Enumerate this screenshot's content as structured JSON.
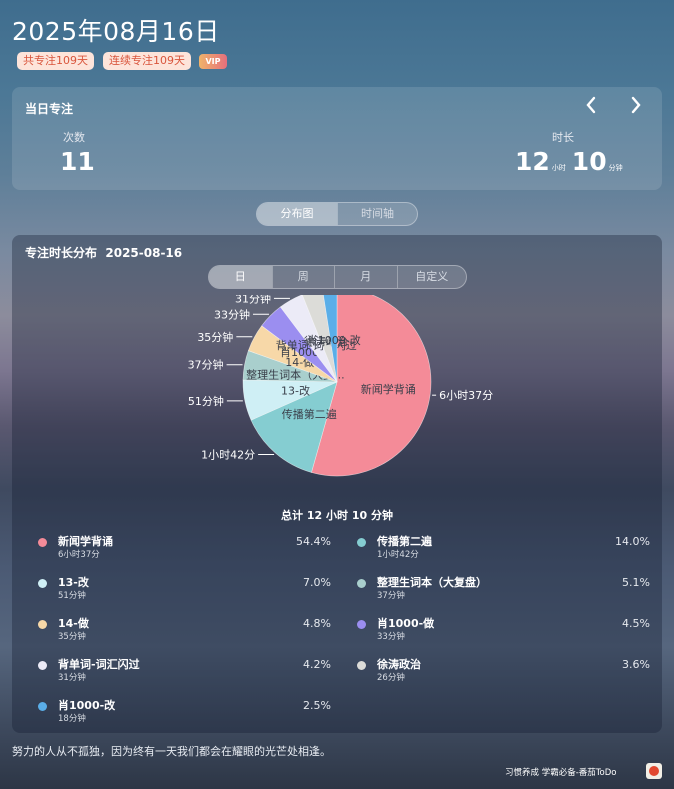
{
  "header": {
    "date": "2025年08月16日",
    "total_days_badge": "共专注109天",
    "streak_badge": "连续专注109天",
    "vip_badge": "VIP"
  },
  "daily": {
    "title": "当日专注",
    "count_label": "次数",
    "count_value": "11",
    "duration_label": "时长",
    "hours": "12",
    "hours_unit": "小时",
    "minutes": "10",
    "minutes_unit": "分钟",
    "prev_icon": "chevron-left-icon",
    "next_icon": "chevron-right-icon"
  },
  "view_tabs": [
    "分布图",
    "时间轴"
  ],
  "distribution": {
    "title": "专注时长分布",
    "date": "2025-08-16",
    "range_tabs": [
      "日",
      "周",
      "月",
      "自定义"
    ],
    "total_text": "总计 12 小时 10 分钟"
  },
  "chart_data": {
    "type": "pie",
    "title": "",
    "slices": [
      {
        "name": "新闻学背诵",
        "duration": "6小时37分",
        "minutes": 397,
        "percent": "54.4%",
        "color": "#f48b98",
        "outer_label": "6小时37分",
        "inner_label": "新闻学背诵"
      },
      {
        "name": "传播第二遍",
        "duration": "1小时42分",
        "minutes": 102,
        "percent": "14.0%",
        "color": "#85cdd1",
        "outer_label": "1小时42分",
        "inner_label": "传播第二遍"
      },
      {
        "name": "13-改",
        "duration": "51分钟",
        "minutes": 51,
        "percent": "7.0%",
        "color": "#cfeff5",
        "outer_label": "51分钟",
        "inner_label": "13-改"
      },
      {
        "name": "整理生词本（大复盘）",
        "duration": "37分钟",
        "minutes": 37,
        "percent": "5.1%",
        "color": "#a9cfcd",
        "outer_label": "37分钟",
        "inner_label": "整理生词本（大复..."
      },
      {
        "name": "14-做",
        "duration": "35分钟",
        "minutes": 35,
        "percent": "4.8%",
        "color": "#f7d8a8",
        "outer_label": "35分钟",
        "inner_label": "14-做"
      },
      {
        "name": "肖1000-做",
        "duration": "33分钟",
        "minutes": 33,
        "percent": "4.5%",
        "color": "#9b8ef0",
        "outer_label": "33分钟",
        "inner_label": "肖1000-做"
      },
      {
        "name": "背单词-词汇闪过",
        "duration": "31分钟",
        "minutes": 31,
        "percent": "4.2%",
        "color": "#ecebf7",
        "outer_label": "31分钟",
        "inner_label": "背单词-词汇闪过"
      },
      {
        "name": "徐涛政治",
        "duration": "26分钟",
        "minutes": 26,
        "percent": "3.6%",
        "color": "#dcdcd8",
        "outer_label": "26分钟",
        "inner_label": "徐涛政治"
      },
      {
        "name": "肖1000-改",
        "duration": "18分钟",
        "minutes": 18,
        "percent": "2.5%",
        "color": "#5aaee8",
        "outer_label": "18分钟",
        "inner_label": "肖1000-改"
      }
    ]
  },
  "footer": {
    "quote": "努力的人从不孤独，因为终有一天我们都会在耀眼的光芒处相逢。",
    "brand": "习惯养成 学霸必备-番茄ToDo",
    "brand_icon": "tomato-logo-icon"
  }
}
